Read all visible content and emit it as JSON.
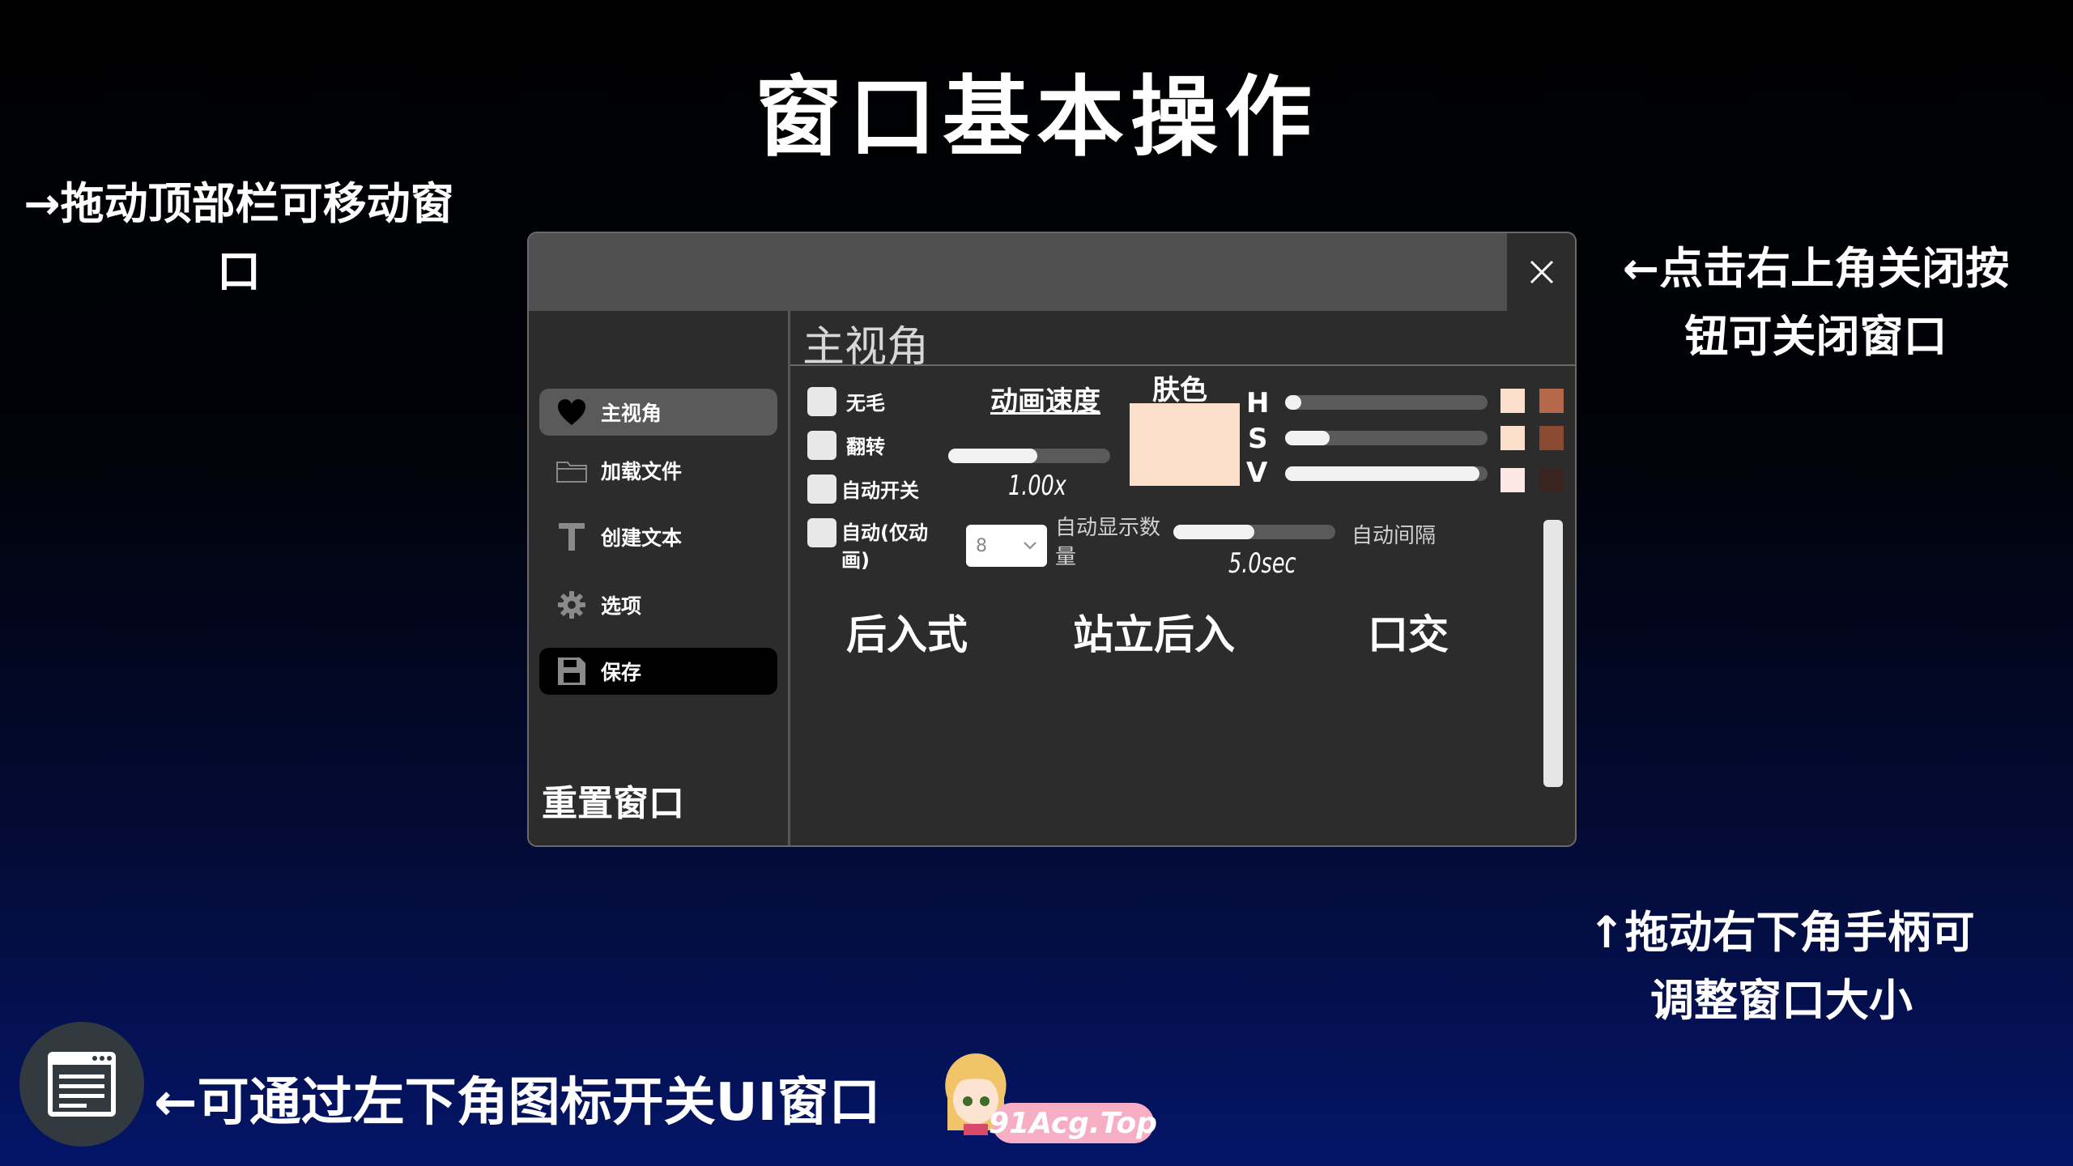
{
  "page": {
    "title": "窗口基本操作",
    "note_drag": "→拖动顶部栏可移动窗口",
    "note_close": "←点击右上角关闭按钮可关闭窗口",
    "note_resize": "↑拖动右下角手柄可调整窗口大小",
    "note_toggle": "←可通过左下角图标开关UI窗口"
  },
  "window": {
    "close_icon": "close-icon",
    "sidebar": {
      "items": [
        {
          "label": "主视角",
          "icon": "heart-icon",
          "state": "active"
        },
        {
          "label": "加载文件",
          "icon": "folder-icon"
        },
        {
          "label": "创建文本",
          "icon": "text-t-icon"
        },
        {
          "label": "选项",
          "icon": "gear-icon"
        },
        {
          "label": "保存",
          "icon": "floppy-disk-icon",
          "state": "highlighted"
        }
      ],
      "reset_label": "重置窗口"
    },
    "panel": {
      "title": "主视角",
      "checkboxes": [
        {
          "label": "无毛",
          "checked": false
        },
        {
          "label": "翻转",
          "checked": false
        },
        {
          "label": "自动开关",
          "checked": false
        },
        {
          "label": "自动(仅动画)",
          "checked": false
        }
      ],
      "animation_speed": {
        "label": "动画速度",
        "value_text": "1.00x",
        "fill": 0.55
      },
      "auto_display_count": {
        "label": "自动显示数量",
        "selected": "8"
      },
      "auto_interval": {
        "label": "自动间隔",
        "value_text": "5.0sec",
        "fill": 0.5
      },
      "skin": {
        "label": "肤色",
        "color": "#fde0cc",
        "sliders": [
          {
            "letter": "H",
            "fill": 0.08,
            "swatch_light": "#fde0cc",
            "swatch_dark": "#b5674a"
          },
          {
            "letter": "S",
            "fill": 0.22,
            "swatch_light": "#fde0cc",
            "swatch_dark": "#8a4a32"
          },
          {
            "letter": "V",
            "fill": 0.96,
            "swatch_light": "#fde8e6",
            "swatch_dark": "#3a2420"
          }
        ]
      },
      "poses": [
        "后入式",
        "站立后入",
        "口交"
      ]
    }
  },
  "ui_toggle_icon": "window-list-icon",
  "watermark": {
    "text": "91Acg.Top"
  }
}
